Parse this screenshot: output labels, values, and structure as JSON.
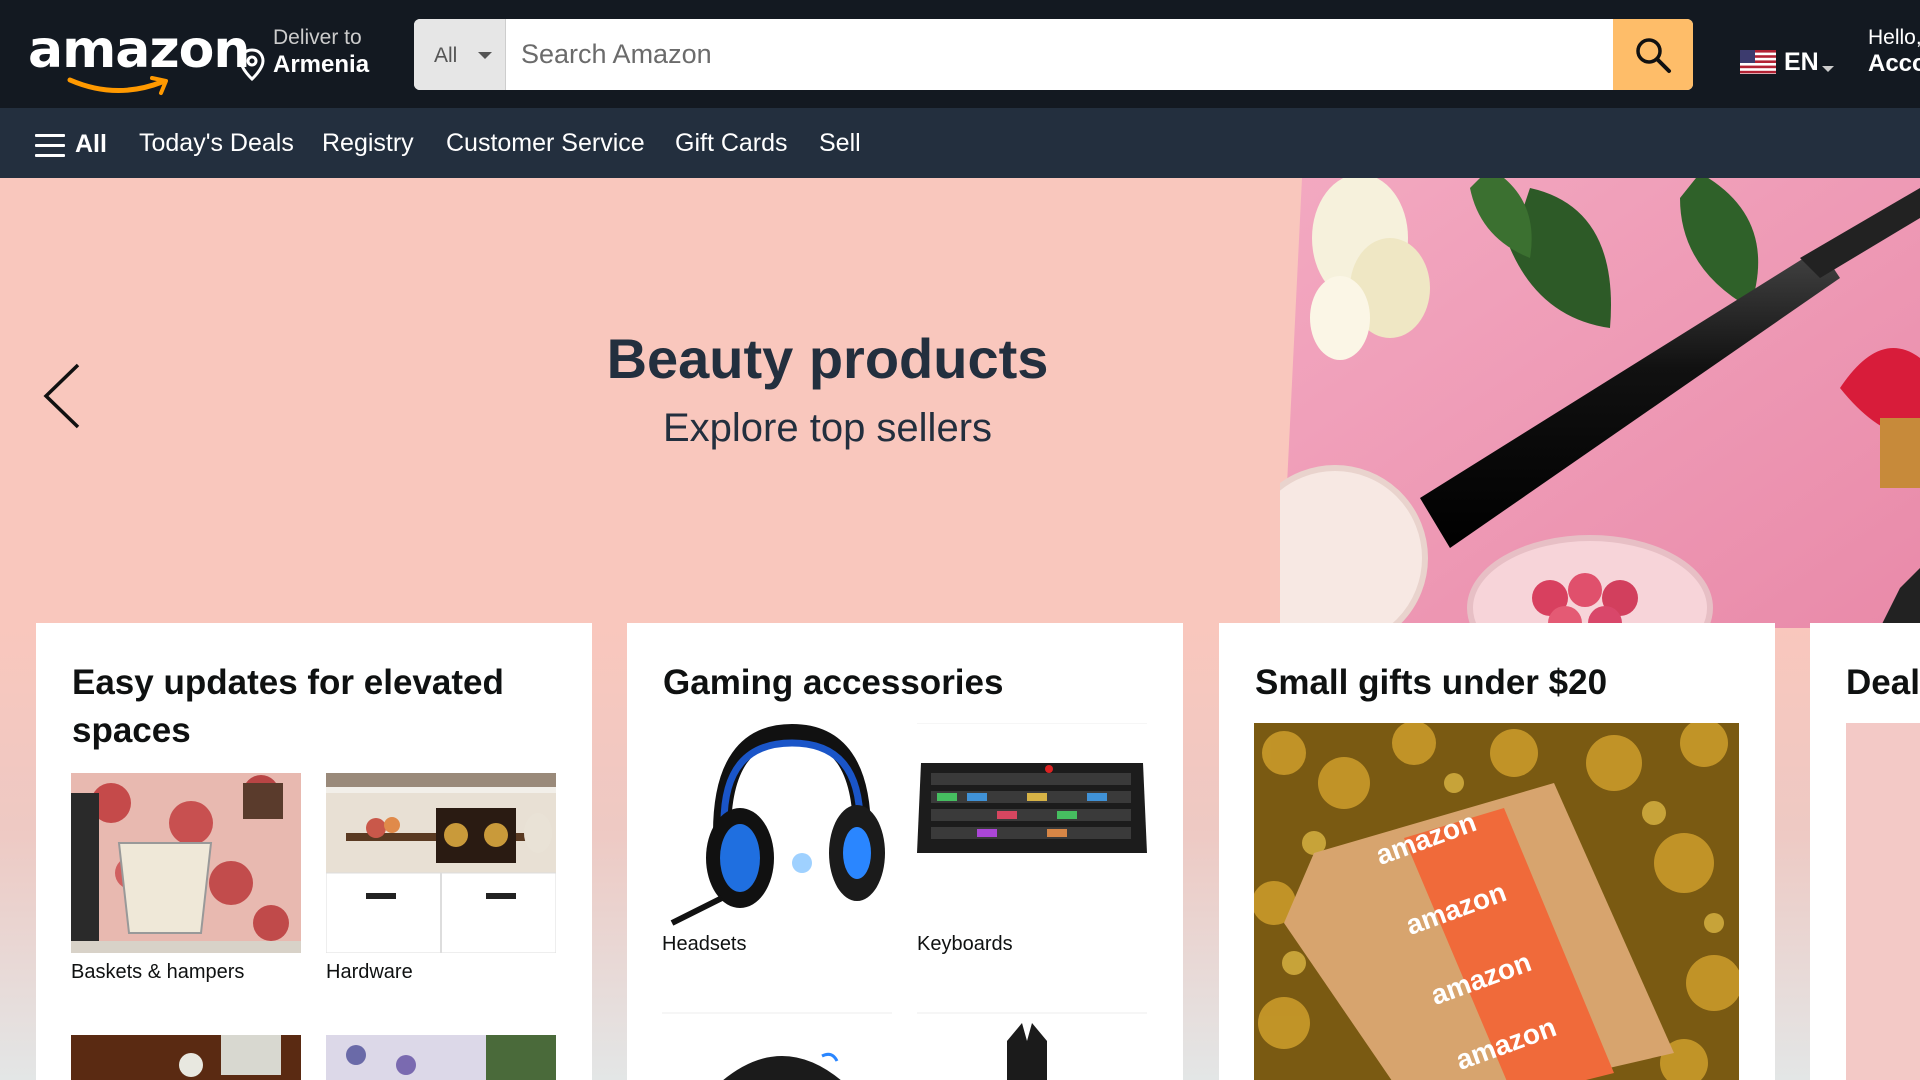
{
  "header": {
    "logo_text": "amazon",
    "deliver": {
      "line1": "Deliver to",
      "line2": "Armenia"
    },
    "search": {
      "category": "All",
      "placeholder": "Search Amazon"
    },
    "language": "EN",
    "account": {
      "line1": "Hello, sign in",
      "line2": "Account & Lists"
    },
    "colors": {
      "nav_bg": "#131921",
      "subnav_bg": "#232f3e",
      "search_button": "#febd69"
    }
  },
  "subnav": {
    "all_label": "All",
    "items": [
      "Today's Deals",
      "Registry",
      "Customer Service",
      "Gift Cards",
      "Sell"
    ]
  },
  "hero": {
    "title": "Beauty products",
    "subtitle": "Explore top sellers"
  },
  "cards": [
    {
      "title": "Easy updates for elevated spaces",
      "tiles": [
        {
          "label": "Baskets & hampers"
        },
        {
          "label": "Hardware"
        },
        {
          "label": ""
        },
        {
          "label": ""
        }
      ]
    },
    {
      "title": "Gaming accessories",
      "tiles": [
        {
          "label": "Headsets"
        },
        {
          "label": "Keyboards"
        },
        {
          "label": ""
        },
        {
          "label": ""
        }
      ]
    },
    {
      "title": "Small gifts under $20",
      "box_text": [
        "amazon",
        "amazon",
        "amazon",
        "amazon"
      ]
    },
    {
      "title": "Deal"
    }
  ]
}
